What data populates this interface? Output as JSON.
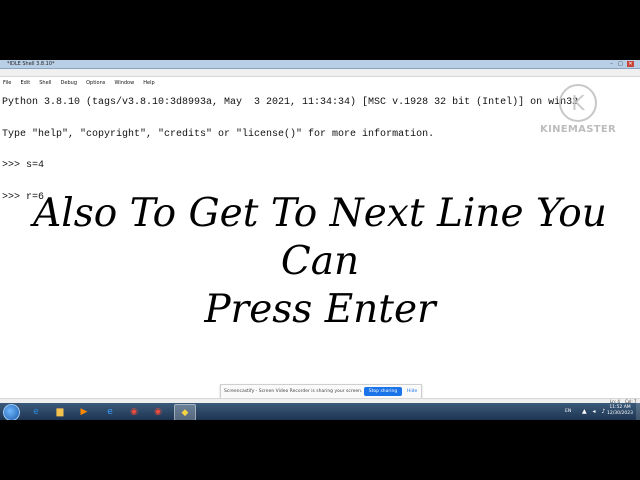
{
  "window": {
    "title": "*IDLE Shell 3.8.10*",
    "controls": {
      "minimize": "–",
      "maximize": "□",
      "close": "✕"
    }
  },
  "menu": [
    "File",
    "Edit",
    "Shell",
    "Debug",
    "Options",
    "Window",
    "Help"
  ],
  "shell": {
    "lines": [
      "Python 3.8.10 (tags/v3.8.10:3d8993a, May  3 2021, 11:34:34) [MSC v.1928 32 bit (Intel)] on win32",
      "Type \"help\", \"copyright\", \"credits\" or \"license()\" for more information.",
      ">>> s=4",
      ">>> r=6"
    ]
  },
  "caption": {
    "line1": "Also To Get To Next Line You Can",
    "line2": "Press Enter"
  },
  "watermark": {
    "text": "KINEMASTER",
    "logo_letter": "K"
  },
  "notification": {
    "message": "Screencastify - Screen Video Recorder is sharing your screen.",
    "stop_label": "Stop sharing",
    "hide_label": "Hide"
  },
  "status_bar": {
    "line": "Ln: 4",
    "col": "Col: 7"
  },
  "taskbar": {
    "apps": [
      {
        "icon": "ie-icon",
        "glyph": "e",
        "color": "#2a8fe0",
        "active": false
      },
      {
        "icon": "folder-icon",
        "glyph": "▆",
        "color": "#f2c14e",
        "active": false
      },
      {
        "icon": "media-player-icon",
        "glyph": "▶",
        "color": "#ff8a00",
        "active": false
      },
      {
        "icon": "ie-icon",
        "glyph": "e",
        "color": "#3aa0ff",
        "active": false
      },
      {
        "icon": "chrome-icon",
        "glyph": "◉",
        "color": "#e84c3d",
        "active": false
      },
      {
        "icon": "chrome-icon",
        "glyph": "◉",
        "color": "#e84c3d",
        "active": false
      },
      {
        "icon": "python-idle-icon",
        "glyph": "◆",
        "color": "#f5d442",
        "active": true
      }
    ],
    "language": "EN",
    "tray_glyphs": "▲ ◂ ♪",
    "time": "11:52 AM",
    "date": "12/30/2023"
  }
}
